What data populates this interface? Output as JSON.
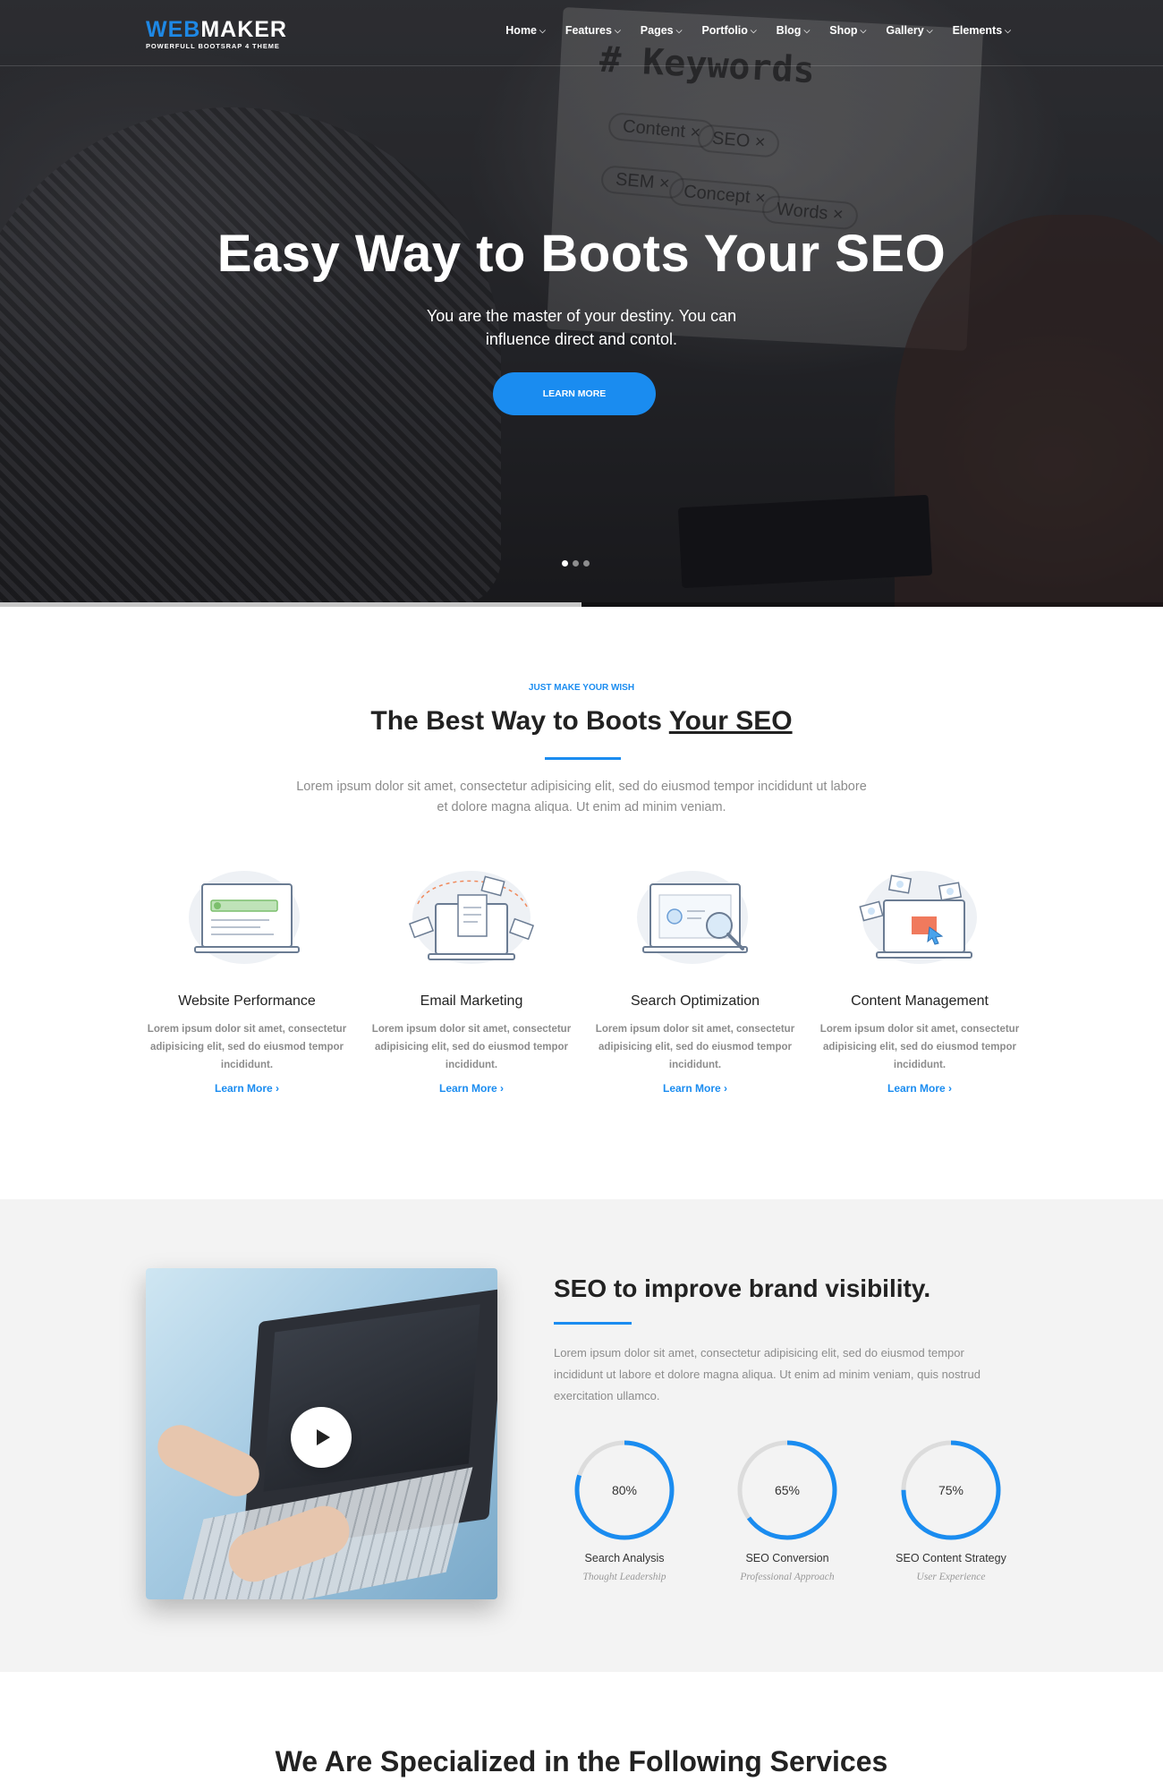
{
  "brand": {
    "name_part1": "WEB",
    "name_part2": "MAKER",
    "tagline": "POWERFULL BOOTSRAP 4 THEME"
  },
  "nav": {
    "items": [
      {
        "label": "Home"
      },
      {
        "label": "Features"
      },
      {
        "label": "Pages"
      },
      {
        "label": "Portfolio"
      },
      {
        "label": "Blog"
      },
      {
        "label": "Shop"
      },
      {
        "label": "Gallery"
      },
      {
        "label": "Elements"
      }
    ]
  },
  "hero": {
    "title": "Easy Way to Boots Your SEO",
    "subtitle": "You are the master of your destiny. You can influence direct and contol.",
    "button": "LEARN MORE",
    "bg_words": {
      "keywords": "# Keywords",
      "chips": [
        "Content ×",
        "SEO ×",
        "SEM ×",
        "Concept ×",
        "Words ×"
      ]
    },
    "slide_count": 3,
    "active_slide": 1,
    "slide_progress": 0.5
  },
  "intro": {
    "kicker": "JUST MAKE YOUR WISH",
    "title_plain": "The Best Way to Boots ",
    "title_underlined": "Your SEO",
    "description": "Lorem ipsum dolor sit amet, consectetur adipisicing elit, sed do eiusmod tempor incididunt ut labore et dolore magna aliqua. Ut enim ad minim veniam."
  },
  "features": [
    {
      "icon": "website-performance-icon",
      "title": "Website Performance",
      "text": "Lorem ipsum dolor sit amet, consectetur adipisicing elit, sed do eiusmod tempor incididunt.",
      "link": "Learn More"
    },
    {
      "icon": "email-marketing-icon",
      "title": "Email Marketing",
      "text": "Lorem ipsum dolor sit amet, consectetur adipisicing elit, sed do eiusmod tempor incididunt.",
      "link": "Learn More"
    },
    {
      "icon": "search-optimization-icon",
      "title": "Search Optimization",
      "text": "Lorem ipsum dolor sit amet, consectetur adipisicing elit, sed do eiusmod tempor incididunt.",
      "link": "Learn More"
    },
    {
      "icon": "content-management-icon",
      "title": "Content Management",
      "text": "Lorem ipsum dolor sit amet, consectetur adipisicing elit, sed do eiusmod tempor incididunt.",
      "link": "Learn More"
    }
  ],
  "brand_section": {
    "title": "SEO to improve brand visibility.",
    "description": "Lorem ipsum dolor sit amet, consectetur adipisicing elit, sed do eiusmod tempor incididunt ut labore et dolore magna aliqua. Ut enim ad minim veniam, quis nostrud exercitation ullamco.",
    "stats": [
      {
        "value": 80,
        "label": "80%",
        "name": "Search Analysis",
        "sub": "Thought Leadership"
      },
      {
        "value": 65,
        "label": "65%",
        "name": "SEO Conversion",
        "sub": "Professional Approach"
      },
      {
        "value": 75,
        "label": "75%",
        "name": "SEO Content Strategy",
        "sub": "User Experience"
      }
    ]
  },
  "services": {
    "title": "We Are Specialized in the Following Services"
  },
  "colors": {
    "accent": "#1a8cf0",
    "ring_track": "#dcdcdc",
    "text_muted": "#8c8c8c"
  }
}
